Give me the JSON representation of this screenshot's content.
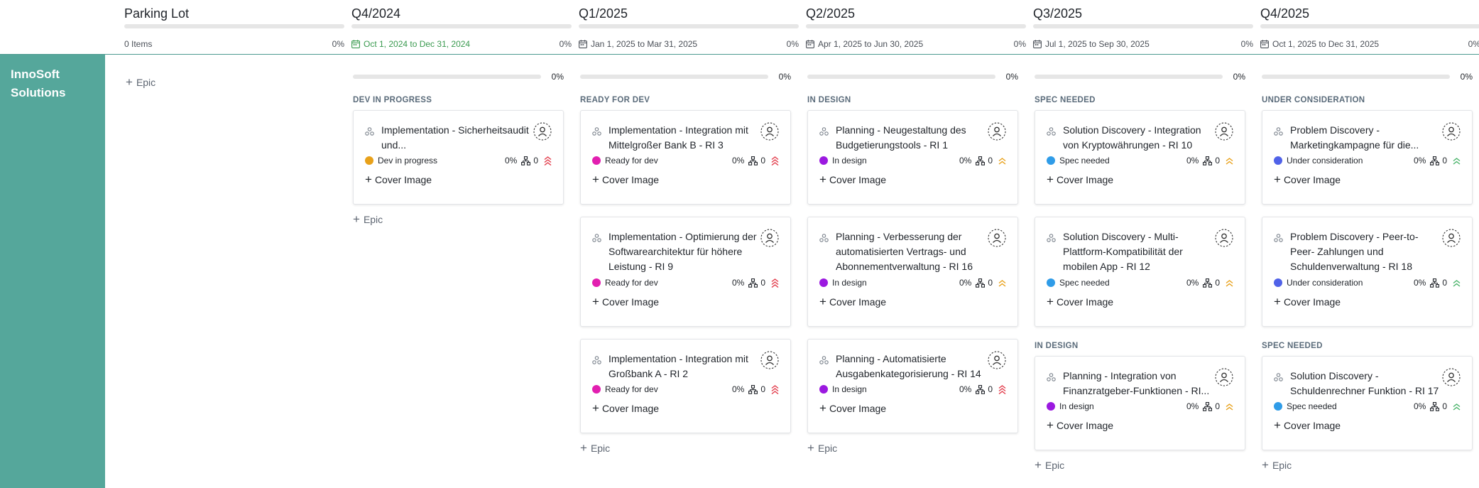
{
  "swimlane": {
    "name": "InnoSoft Solutions"
  },
  "add_epic_label": "Epic",
  "cover_image_label": "Cover Image",
  "colors": {
    "swimlane": "#55a79b",
    "dev_in_progress": "#e8a11a",
    "ready_for_dev": "#e21fb0",
    "in_design": "#9b19e0",
    "spec_needed": "#2f9ce8",
    "under_consideration": "#5062e8",
    "priority_high": "#e23b4a",
    "priority_medium": "#e8a11a",
    "priority_low": "#49b36a"
  },
  "columns": [
    {
      "title": "Parking Lot",
      "subtitle": "0 Items",
      "pct": "0%",
      "groups": []
    },
    {
      "title": "Q4/2024",
      "subtitle": "Oct 1, 2024 to Dec 31, 2024",
      "pct": "0%",
      "lane_pct": "0%",
      "groups": [
        {
          "label": "DEV IN PROGRESS",
          "cards": [
            {
              "title": "Implementation - Sicherheitsaudit und...",
              "status": "Dev in progress",
              "status_color": "#e8a11a",
              "pct": "0%",
              "children": "0",
              "priority": "high"
            }
          ]
        }
      ]
    },
    {
      "title": "Q1/2025",
      "subtitle": "Jan 1, 2025 to Mar 31, 2025",
      "pct": "0%",
      "lane_pct": "0%",
      "groups": [
        {
          "label": "READY FOR DEV",
          "cards": [
            {
              "title": "Implementation - Integration mit Mittelgroßer Bank B - RI 3",
              "status": "Ready for dev",
              "status_color": "#e21fb0",
              "pct": "0%",
              "children": "0",
              "priority": "high"
            },
            {
              "title": "Implementation - Optimierung der Softwarearchitektur für höhere Leistung - RI 9",
              "status": "Ready for dev",
              "status_color": "#e21fb0",
              "pct": "0%",
              "children": "0",
              "priority": "high"
            },
            {
              "title": "Implementation - Integration mit Großbank A - RI 2",
              "status": "Ready for dev",
              "status_color": "#e21fb0",
              "pct": "0%",
              "children": "0",
              "priority": "high"
            }
          ]
        }
      ]
    },
    {
      "title": "Q2/2025",
      "subtitle": "Apr 1, 2025 to Jun 30, 2025",
      "pct": "0%",
      "lane_pct": "0%",
      "groups": [
        {
          "label": "IN DESIGN",
          "cards": [
            {
              "title": "Planning - Neugestaltung des Budgetierungstools - RI 1",
              "status": "In design",
              "status_color": "#9b19e0",
              "pct": "0%",
              "children": "0",
              "priority": "medium"
            },
            {
              "title": "Planning - Verbesserung der automatisierten Vertrags- und Abonnementverwaltung - RI 16",
              "status": "In design",
              "status_color": "#9b19e0",
              "pct": "0%",
              "children": "0",
              "priority": "medium"
            },
            {
              "title": "Planning - Automatisierte Ausgabenkategorisierung - RI 14",
              "status": "In design",
              "status_color": "#9b19e0",
              "pct": "0%",
              "children": "0",
              "priority": "high"
            }
          ]
        }
      ]
    },
    {
      "title": "Q3/2025",
      "subtitle": "Jul 1, 2025 to Sep 30, 2025",
      "pct": "0%",
      "lane_pct": "0%",
      "groups": [
        {
          "label": "SPEC NEEDED",
          "cards": [
            {
              "title": "Solution Discovery - Integration von Kryptowährungen - RI 10",
              "status": "Spec needed",
              "status_color": "#2f9ce8",
              "pct": "0%",
              "children": "0",
              "priority": "medium"
            },
            {
              "title": "Solution Discovery - Multi-Plattform-Kompatibilität der mobilen App - RI 12",
              "status": "Spec needed",
              "status_color": "#2f9ce8",
              "pct": "0%",
              "children": "0",
              "priority": "medium"
            }
          ]
        },
        {
          "label": "IN DESIGN",
          "cards": [
            {
              "title": "Planning - Integration von Finanzratgeber-Funktionen - RI...",
              "status": "In design",
              "status_color": "#9b19e0",
              "pct": "0%",
              "children": "0",
              "priority": "medium"
            }
          ]
        }
      ]
    },
    {
      "title": "Q4/2025",
      "subtitle": "Oct 1, 2025 to Dec 31, 2025",
      "pct": "0%",
      "lane_pct": "0%",
      "groups": [
        {
          "label": "UNDER CONSIDERATION",
          "cards": [
            {
              "title": "Problem Discovery - Marketingkampagne für die...",
              "status": "Under consideration",
              "status_color": "#5062e8",
              "pct": "0%",
              "children": "0",
              "priority": "low"
            },
            {
              "title": "Problem Discovery - Peer-to-Peer- Zahlungen und Schuldenverwaltung - RI 18",
              "status": "Under consideration",
              "status_color": "#5062e8",
              "pct": "0%",
              "children": "0",
              "priority": "low"
            }
          ]
        },
        {
          "label": "SPEC NEEDED",
          "cards": [
            {
              "title": "Solution Discovery - Schuldenrechner Funktion - RI 17",
              "status": "Spec needed",
              "status_color": "#2f9ce8",
              "pct": "0%",
              "children": "0",
              "priority": "low"
            }
          ]
        }
      ]
    }
  ]
}
